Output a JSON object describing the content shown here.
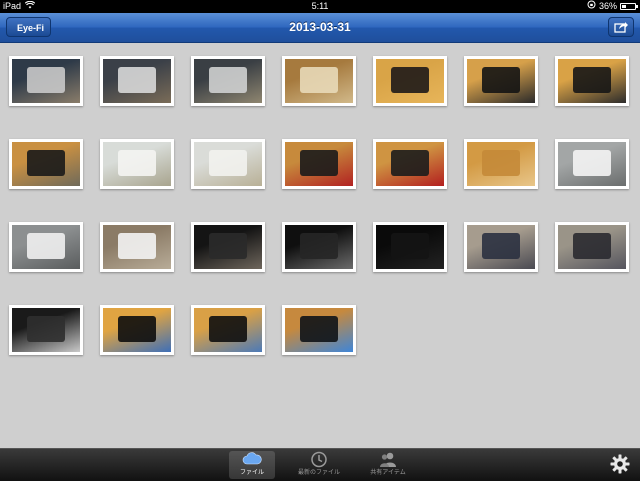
{
  "status_bar": {
    "device": "iPad",
    "time": "5:11",
    "battery": "36%",
    "battery_level": 0.36
  },
  "nav": {
    "back_label": "Eye-Fi",
    "title": "2013-03-31"
  },
  "photos": [
    {
      "subject": "macbook-desk",
      "colors": [
        "#2e3a48",
        "#c9c9c9",
        "#8a7d6a"
      ]
    },
    {
      "subject": "macbook-desk",
      "colors": [
        "#3b4048",
        "#d8d8d8",
        "#7a6c58"
      ]
    },
    {
      "subject": "macbook-desk",
      "colors": [
        "#3a3f44",
        "#cfd0d0",
        "#8f8670"
      ]
    },
    {
      "subject": "charger-box",
      "colors": [
        "#a67a3e",
        "#e8d9b8",
        "#d1b98a"
      ]
    },
    {
      "subject": "earphones",
      "colors": [
        "#d9a447",
        "#1e1a18",
        "#e7b55a"
      ]
    },
    {
      "subject": "shure-case",
      "colors": [
        "#d6a04a",
        "#141414",
        "#2a2a2a"
      ]
    },
    {
      "subject": "shure-case",
      "colors": [
        "#d9a246",
        "#161616",
        "#2c2c2c"
      ]
    },
    {
      "subject": "shure-case",
      "colors": [
        "#c99042",
        "#1a1a1a",
        "#6f6a5a"
      ]
    },
    {
      "subject": "keyboard",
      "colors": [
        "#d8dcd8",
        "#f4f4f2",
        "#a8a48e"
      ]
    },
    {
      "subject": "keyboard",
      "colors": [
        "#dadcd8",
        "#f2f2ee",
        "#b8b096"
      ]
    },
    {
      "subject": "headphones",
      "colors": [
        "#c78a3c",
        "#1b1b1b",
        "#b22222"
      ]
    },
    {
      "subject": "headphones",
      "colors": [
        "#cf9442",
        "#1c1c1c",
        "#b31f1f"
      ]
    },
    {
      "subject": "small-item",
      "colors": [
        "#d39a44",
        "#c48a38",
        "#e8c68a"
      ]
    },
    {
      "subject": "airport-express",
      "colors": [
        "#a3a6a6",
        "#f4f4f4",
        "#6a6d6d"
      ]
    },
    {
      "subject": "airport-express",
      "colors": [
        "#8c8f90",
        "#f0f0f0",
        "#5a5d5e"
      ]
    },
    {
      "subject": "airport-express",
      "colors": [
        "#8b7b66",
        "#f3f3f3",
        "#b8ac98"
      ]
    },
    {
      "subject": "monitor",
      "colors": [
        "#141414",
        "#2a2a2a",
        "#6e665c"
      ]
    },
    {
      "subject": "monitor",
      "colors": [
        "#0f0f0f",
        "#262626",
        "#6b6b6b"
      ]
    },
    {
      "subject": "dark-room",
      "colors": [
        "#0a0a0a",
        "#141414",
        "#222222"
      ]
    },
    {
      "subject": "clothes-rack",
      "colors": [
        "#a69c8e",
        "#2b3140",
        "#4a4a52"
      ]
    },
    {
      "subject": "clothes-rack",
      "colors": [
        "#9a9488",
        "#2a2a30",
        "#55555e"
      ]
    },
    {
      "subject": "black-bag",
      "colors": [
        "#1a1a1a",
        "#2f2f2f",
        "#c9c9c9"
      ]
    },
    {
      "subject": "iphone",
      "colors": [
        "#e0a442",
        "#0e0e0e",
        "#3e6fb8"
      ]
    },
    {
      "subject": "iphone",
      "colors": [
        "#d9a046",
        "#101010",
        "#4c7ab8"
      ]
    },
    {
      "subject": "ipad-mini",
      "colors": [
        "#c6893e",
        "#101418",
        "#3f86d8"
      ]
    }
  ],
  "tabbar": {
    "tabs": [
      {
        "label": "ファイル",
        "icon": "cloud-icon",
        "active": true
      },
      {
        "label": "最新のファイル",
        "icon": "clock-icon",
        "active": false
      },
      {
        "label": "共有アイテム",
        "icon": "people-icon",
        "active": false
      }
    ],
    "settings_icon": "gear-icon"
  }
}
